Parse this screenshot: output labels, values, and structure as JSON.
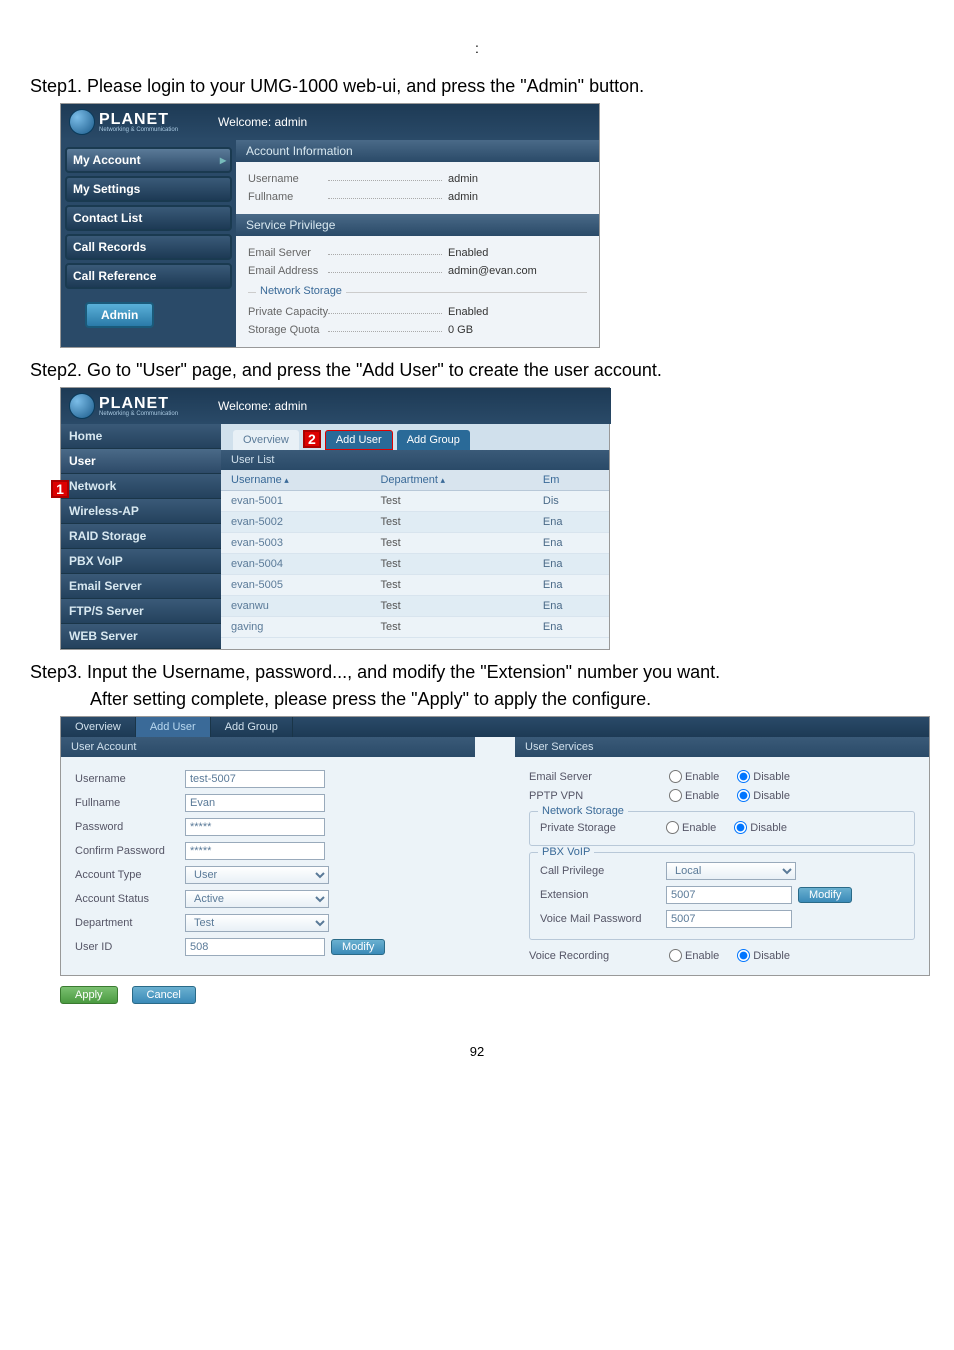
{
  "page_number": "92",
  "title_line": ":",
  "step1": {
    "text": "Step1. Please login to your UMG-1000 web-ui, and press the \"Admin\" button.",
    "logo": "PLANET",
    "logo_sub": "Networking & Communication",
    "welcome": "Welcome: admin",
    "nav": [
      "My Account",
      "My Settings",
      "Contact List",
      "Call Records",
      "Call Reference"
    ],
    "admin_btn": "Admin",
    "account_info_hdr": "Account Information",
    "service_priv_hdr": "Service Privilege",
    "network_storage_hdr": "Network Storage",
    "rows": {
      "username_l": "Username",
      "username_v": "admin",
      "fullname_l": "Fullname",
      "fullname_v": "admin",
      "emailserver_l": "Email Server",
      "emailserver_v": "Enabled",
      "emailaddr_l": "Email Address",
      "emailaddr_v": "admin@evan.com",
      "privcap_l": "Private Capacity",
      "privcap_v": "Enabled",
      "quota_l": "Storage Quota",
      "quota_v": "0 GB"
    }
  },
  "step2": {
    "text": "Step2. Go to \"User\" page, and press the \"Add User\" to create the user account.",
    "welcome": "Welcome: admin",
    "marker1": "1",
    "marker2": "2",
    "nav": [
      "Home",
      "User",
      "Network",
      "Wireless-AP",
      "RAID Storage",
      "PBX VoIP",
      "Email Server",
      "FTP/S Server",
      "WEB Server"
    ],
    "tabs": {
      "overview": "Overview",
      "adduser": "Add User",
      "addgroup": "Add Group"
    },
    "list_hdr": "User List",
    "cols": {
      "username": "Username",
      "department": "Department",
      "extra": "Em"
    },
    "rows": [
      {
        "u": "evan-5001",
        "d": "Test",
        "s": "Dis"
      },
      {
        "u": "evan-5002",
        "d": "Test",
        "s": "Ena"
      },
      {
        "u": "evan-5003",
        "d": "Test",
        "s": "Ena"
      },
      {
        "u": "evan-5004",
        "d": "Test",
        "s": "Ena"
      },
      {
        "u": "evan-5005",
        "d": "Test",
        "s": "Ena"
      },
      {
        "u": "evanwu",
        "d": "Test",
        "s": "Ena"
      },
      {
        "u": "gaving",
        "d": "Test",
        "s": "Ena"
      }
    ]
  },
  "step3": {
    "text_a": "Step3. Input the Username, password..., and modify the \"Extension\" number you want.",
    "text_b": "After setting complete, please press the \"Apply\" to apply the configure.",
    "tabs": {
      "overview": "Overview",
      "adduser": "Add User",
      "addgroup": "Add Group"
    },
    "left_hdr": "User Account",
    "right_hdr": "User Services",
    "left": {
      "username_l": "Username",
      "username_v": "test-5007",
      "fullname_l": "Fullname",
      "fullname_v": "Evan",
      "password_l": "Password",
      "password_v": "*****",
      "confirm_l": "Confirm Password",
      "confirm_v": "*****",
      "accttype_l": "Account Type",
      "accttype_v": "User",
      "acctstatus_l": "Account Status",
      "acctstatus_v": "Active",
      "dept_l": "Department",
      "dept_v": "Test",
      "userid_l": "User ID",
      "userid_v": "508",
      "modify": "Modify"
    },
    "right": {
      "emailserver_l": "Email Server",
      "pptp_l": "PPTP VPN",
      "netstor_l": "Network Storage",
      "privstor_l": "Private Storage",
      "pbx_l": "PBX VoIP",
      "callpriv_l": "Call Privilege",
      "callpriv_v": "Local",
      "ext_l": "Extension",
      "ext_v": "5007",
      "ext_mod": "Modify",
      "vm_l": "Voice Mail Password",
      "vm_v": "5007",
      "vrec_l": "Voice Recording",
      "enable": "Enable",
      "disable": "Disable"
    },
    "apply": "Apply",
    "cancel": "Cancel"
  }
}
